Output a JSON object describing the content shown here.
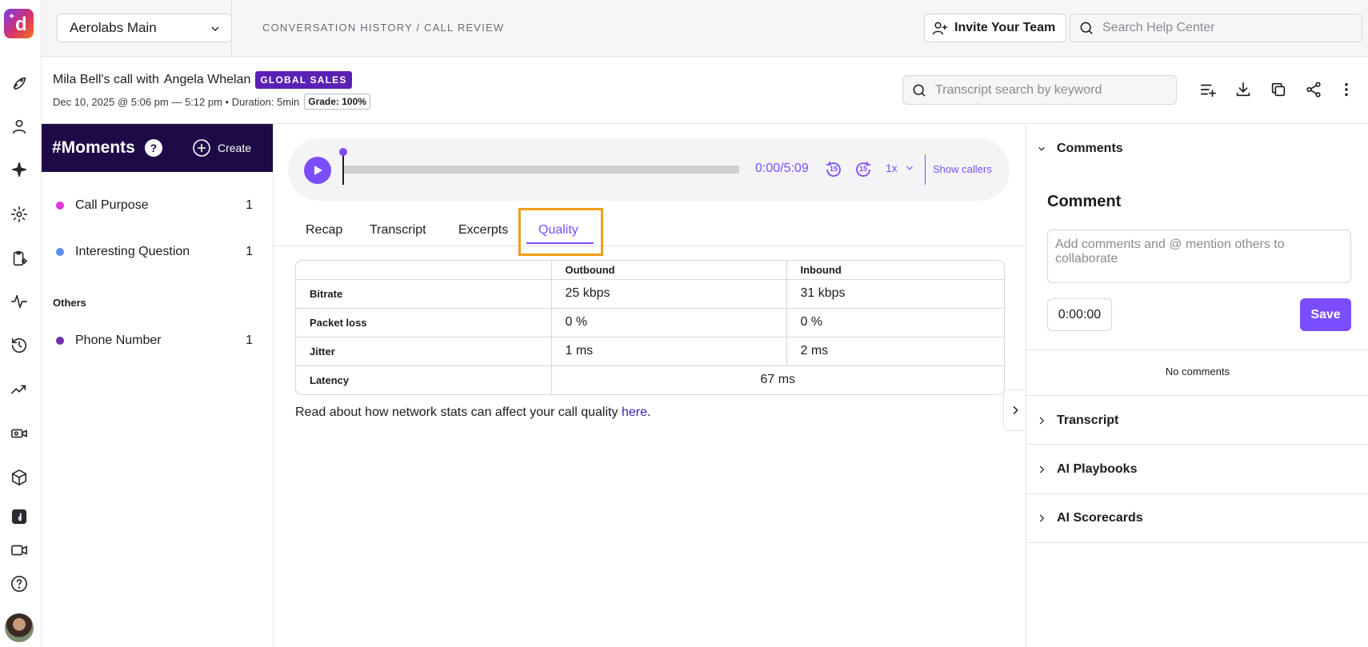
{
  "workspace": {
    "name": "Aerolabs Main"
  },
  "breadcrumb": "CONVERSATION HISTORY / CALL REVIEW",
  "header": {
    "invite_label": "Invite Your Team",
    "help_search_placeholder": "Search Help Center"
  },
  "call": {
    "caller": "Mila Bell's call with",
    "callee": "Angela Whelan",
    "team_badge": "GLOBAL SALES",
    "meta": "Dec 10, 2025 @ 5:06 pm — 5:12 pm • Duration: 5min",
    "grade": "Grade: 100%",
    "transcript_search_placeholder": "Transcript search by keyword"
  },
  "moments": {
    "title": "#Moments",
    "help": "?",
    "create_label": "Create",
    "items": [
      {
        "label": "Call Purpose",
        "count": "1",
        "color": "#e535d8"
      },
      {
        "label": "Interesting Question",
        "count": "1",
        "color": "#5b8ef0"
      }
    ],
    "others_label": "Others",
    "others": [
      {
        "label": "Phone Number",
        "count": "1",
        "color": "#6b2fa8"
      }
    ]
  },
  "player": {
    "time": "0:00/5:09",
    "skip_back": "15",
    "skip_forward": "15",
    "speed": "1x",
    "show_callers": "Show callers",
    "progress": 0.0
  },
  "tabs": [
    "Recap",
    "Transcript",
    "Excerpts",
    "Quality"
  ],
  "active_tab": "Quality",
  "quality": {
    "headers": [
      "",
      "Outbound",
      "Inbound"
    ],
    "rows": [
      {
        "label": "Bitrate",
        "outbound": "25 kbps",
        "inbound": "31 kbps"
      },
      {
        "label": "Packet loss",
        "outbound": "0 %",
        "inbound": "0 %"
      },
      {
        "label": "Jitter",
        "outbound": "1 ms",
        "inbound": "2 ms"
      }
    ],
    "latency_label": "Latency",
    "latency_value": "67 ms",
    "note_text": "Read about how network stats can affect your call quality ",
    "note_link": "here",
    "note_end": "."
  },
  "right_panel": {
    "comments_label": "Comments",
    "comment_title": "Comment",
    "comment_placeholder": "Add comments and @ mention others to collaborate",
    "timestamp": "0:00:00",
    "save_label": "Save",
    "no_comments": "No comments",
    "sections": [
      "Transcript",
      "AI Playbooks",
      "AI Scorecards"
    ]
  },
  "colors": {
    "accent": "#7c4dff",
    "moments_header": "#1e0a46",
    "badge": "#5b21b6",
    "highlight": "#f29d1a"
  }
}
